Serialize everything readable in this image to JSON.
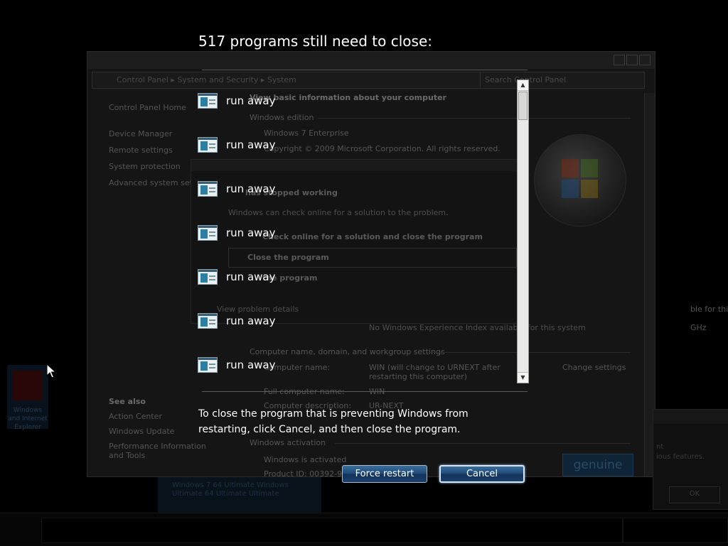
{
  "shutdown_screen": {
    "heading": "517 programs still need to close:",
    "programs": [
      {
        "label": "run away",
        "icon": "application-window-icon"
      },
      {
        "label": "run away",
        "icon": "application-window-icon"
      },
      {
        "label": "run away",
        "icon": "application-window-icon"
      },
      {
        "label": "run away",
        "icon": "application-window-icon"
      },
      {
        "label": "run away",
        "icon": "application-window-icon"
      },
      {
        "label": "run away",
        "icon": "application-window-icon"
      },
      {
        "label": "run away",
        "icon": "application-window-icon"
      }
    ],
    "message": "To close the program that is preventing Windows from restarting, click Cancel, and then close the program.",
    "buttons": {
      "force_restart": "Force restart",
      "cancel": "Cancel"
    },
    "button_color": "#1e4a78"
  },
  "background": {
    "address_bar": "Control Panel  ▸  System and Security  ▸  System",
    "search_placeholder": "Search Control Panel",
    "sidebar": {
      "home": "Control Panel Home",
      "items": [
        "Device Manager",
        "Remote settings",
        "System protection",
        "Advanced system settings"
      ],
      "see_also": "See also",
      "see_also_items": [
        "Action Center",
        "Windows Update",
        "Performance Information and Tools"
      ]
    },
    "main": {
      "title": "View basic information about your computer",
      "edition_header": "Windows edition",
      "edition": "Windows 7 Enterprise",
      "copyright": "Copyright © 2009 Microsoft Corporation.  All rights reserved.",
      "stopped_working": "has stopped working",
      "check_online_text": "Windows can check online for a solution to the problem.",
      "check_online": "Check online for a solution and close the program",
      "close_program": "Close the program",
      "debug_program": "the program",
      "view_details": "View problem details",
      "rating_note": "No Windows Experience Index available for this system",
      "computer_header": "Computer name, domain, and workgroup settings",
      "computer_name_label": "Computer name:",
      "computer_name_value": "WIN (will change to URNEXT after restarting this computer)",
      "change_settings": "Change settings",
      "full_name_label": "Full computer name:",
      "full_name_value": "WIN",
      "description_label": "Computer description:",
      "description_value": "UR-NEXT",
      "activation_header": "Windows activation",
      "activated": "Windows is activated",
      "product_id": "Product ID: 00392-918",
      "processor_value": "GHz",
      "pen_note": "ble for this Display",
      "genuine": "genuine"
    },
    "desktop_icon_label": "Windows and Internet Explorer",
    "popup_text": [
      "nt",
      "ious features."
    ],
    "popup_ok": "OK",
    "lower_text": [
      "Windows 7 64  Ultimate   Windows",
      "Ultimate 64  Ultimate  Ultimate"
    ]
  }
}
